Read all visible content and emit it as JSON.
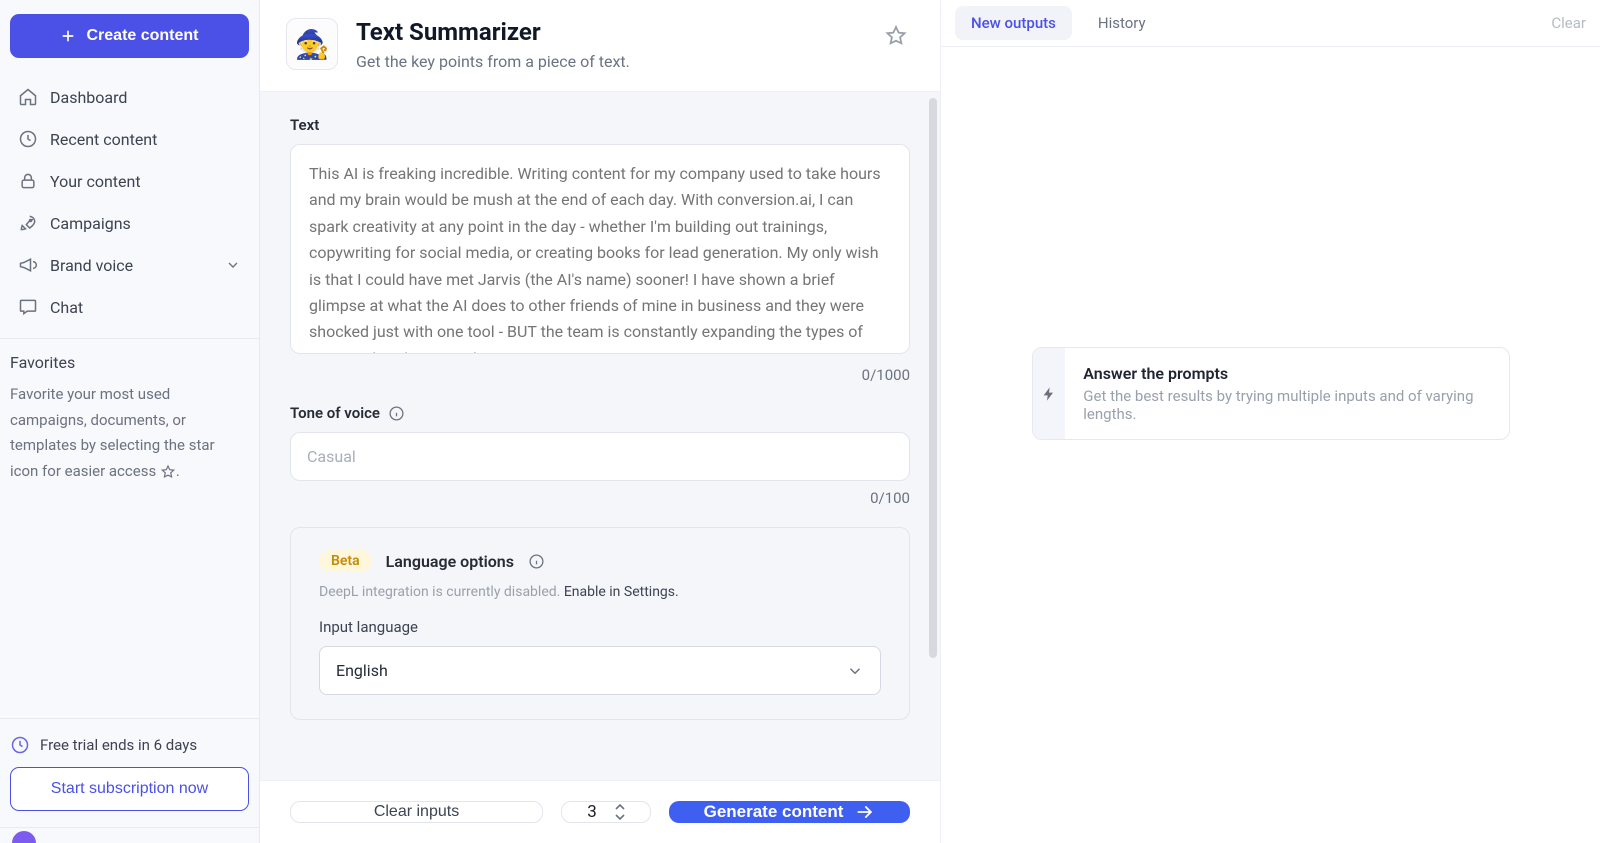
{
  "sidebar": {
    "create_label": "Create content",
    "items": [
      {
        "label": "Dashboard",
        "icon": "home-icon"
      },
      {
        "label": "Recent content",
        "icon": "clock-icon"
      },
      {
        "label": "Your content",
        "icon": "lock-icon"
      },
      {
        "label": "Campaigns",
        "icon": "rocket-icon"
      },
      {
        "label": "Brand voice",
        "icon": "megaphone-icon",
        "has_chevron": true
      },
      {
        "label": "Chat",
        "icon": "chat-icon"
      }
    ],
    "favorites": {
      "header": "Favorites",
      "body_prefix": "Favorite your most used campaigns, documents, or templates by selecting the star icon for easier access ",
      "body_suffix": "."
    },
    "trial_text": "Free trial ends in 6 days",
    "subscribe_label": "Start subscription now"
  },
  "template": {
    "icon_emoji": "🧙",
    "title": "Text Summarizer",
    "subtitle": "Get the key points from a piece of text."
  },
  "fields": {
    "text": {
      "label": "Text",
      "placeholder": "This AI is freaking incredible. Writing content for my company used to take hours and my brain would be mush at the end of each day. With conversion.ai, I can spark creativity at any point in the day - whether I'm building out trainings, copywriting for social media, or creating books for lead generation. My only wish is that I could have met Jarvis (the AI's name) sooner! I have shown a brief glimpse at what the AI does to other friends of mine in business and they were shocked just with one tool - BUT the team is constantly expanding the types of content that the AI produces.",
      "counter": "0/1000"
    },
    "tone": {
      "label": "Tone of voice",
      "placeholder": "Casual",
      "counter": "0/100"
    },
    "language": {
      "beta_badge": "Beta",
      "title": "Language options",
      "note_prefix": "DeepL integration is currently disabled. ",
      "note_link": "Enable in Settings.",
      "input_label": "Input language",
      "input_value": "English"
    }
  },
  "actions": {
    "clear_label": "Clear inputs",
    "count_value": "3",
    "generate_label": "Generate content"
  },
  "right": {
    "tab_new": "New outputs",
    "tab_history": "History",
    "clear_label": "Clear",
    "prompt_title": "Answer the prompts",
    "prompt_sub": "Get the best results by trying multiple inputs and of varying lengths."
  }
}
